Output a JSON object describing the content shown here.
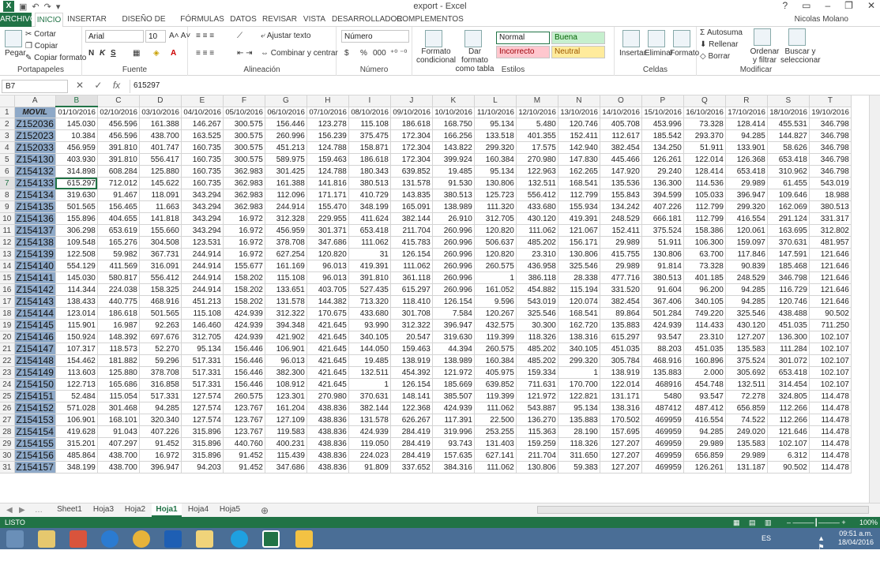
{
  "window": {
    "title": "export - Excel",
    "user": "Nicolas Molano"
  },
  "tabs": [
    "ARCHIVO",
    "INICIO",
    "INSERTAR",
    "DISEÑO DE PÁGINA",
    "FÓRMULAS",
    "DATOS",
    "REVISAR",
    "VISTA",
    "DESARROLLADOR",
    "COMPLEMENTOS"
  ],
  "ribbon": {
    "clipboard": {
      "label": "Portapapeles",
      "paste": "Pegar",
      "cut": "Cortar",
      "copy": "Copiar",
      "format_painter": "Copiar formato"
    },
    "font": {
      "label": "Fuente",
      "family": "Arial",
      "size": "10",
      "bold": "N",
      "italic": "K",
      "underline": "S"
    },
    "alignment": {
      "label": "Alineación",
      "wrap": "Ajustar texto",
      "merge": "Combinar y centrar"
    },
    "number": {
      "label": "Número",
      "format": "Número",
      "currency": "$",
      "percent": "%",
      "thousands": "000"
    },
    "styles": {
      "label": "Estilos",
      "conditional": "Formato condicional",
      "as_table": "Dar formato como tabla",
      "normal": "Normal",
      "good": "Buena",
      "bad": "Incorrecto",
      "neutral": "Neutral"
    },
    "cells": {
      "label": "Celdas",
      "insert": "Insertar",
      "delete": "Eliminar",
      "format": "Formato"
    },
    "editing": {
      "label": "Modificar",
      "autosum": "Autosuma",
      "fill": "Rellenar",
      "clear": "Borrar",
      "sort": "Ordenar y filtrar",
      "find": "Buscar y seleccionar"
    }
  },
  "formula_bar": {
    "name_box": "B7",
    "fx": "fx",
    "content": "615297"
  },
  "columns": [
    "A",
    "B",
    "C",
    "D",
    "E",
    "F",
    "G",
    "H",
    "I",
    "J",
    "K",
    "L",
    "M",
    "N",
    "O",
    "P",
    "Q",
    "R",
    "S",
    "T"
  ],
  "header_row": [
    "MOVIL",
    "01/10/2016",
    "02/10/2016",
    "03/10/2016",
    "04/10/2016",
    "05/10/2016",
    "06/10/2016",
    "07/10/2016",
    "08/10/2016",
    "09/10/2016",
    "10/10/2016",
    "11/10/2016",
    "12/10/2016",
    "13/10/2016",
    "14/10/2016",
    "15/10/2016",
    "16/10/2016",
    "17/10/2016",
    "18/10/2016",
    "19/10/2016"
  ],
  "rows": [
    [
      "Z152036",
      "145.030",
      "456.596",
      "161.388",
      "146.267",
      "300.575",
      "156.446",
      "123.278",
      "115.108",
      "186.618",
      "168.750",
      "95.134",
      "5.480",
      "120.746",
      "405.708",
      "453.996",
      "73.328",
      "128.414",
      "455.531",
      "346.798"
    ],
    [
      "Z152023",
      "10.384",
      "456.596",
      "438.700",
      "163.525",
      "300.575",
      "260.996",
      "156.239",
      "375.475",
      "172.304",
      "166.256",
      "133.518",
      "401.355",
      "152.411",
      "112.617",
      "185.542",
      "293.370",
      "94.285",
      "144.827",
      "346.798"
    ],
    [
      "Z152033",
      "456.959",
      "391.810",
      "401.747",
      "160.735",
      "300.575",
      "451.213",
      "124.788",
      "158.871",
      "172.304",
      "143.822",
      "299.320",
      "17.575",
      "142.940",
      "382.454",
      "134.250",
      "51.911",
      "133.901",
      "58.626",
      "346.798"
    ],
    [
      "Z154130",
      "403.930",
      "391.810",
      "556.417",
      "160.735",
      "300.575",
      "589.975",
      "159.463",
      "186.618",
      "172.304",
      "399.924",
      "160.384",
      "270.980",
      "147.830",
      "445.466",
      "126.261",
      "122.014",
      "126.368",
      "653.418",
      "346.798"
    ],
    [
      "Z154132",
      "314.898",
      "608.284",
      "125.880",
      "160.735",
      "362.983",
      "301.425",
      "124.788",
      "180.343",
      "639.852",
      "19.485",
      "95.134",
      "122.963",
      "162.265",
      "147.920",
      "29.240",
      "128.414",
      "653.418",
      "310.962",
      "346.798"
    ],
    [
      "Z154133",
      "615.297",
      "712.012",
      "145.622",
      "160.735",
      "362.983",
      "161.388",
      "141.816",
      "380.513",
      "131.578",
      "91.530",
      "130.806",
      "132.511",
      "168.541",
      "135.536",
      "136.300",
      "114.536",
      "29.989",
      "61.455",
      "543.019"
    ],
    [
      "Z154134",
      "319.630",
      "91.467",
      "118.091",
      "343.294",
      "362.983",
      "112.096",
      "171.171",
      "410.729",
      "143.835",
      "380.513",
      "125.723",
      "556.412",
      "112.799",
      "155.843",
      "394.599",
      "105.033",
      "396.947",
      "109.646",
      "18.988"
    ],
    [
      "Z154135",
      "501.565",
      "156.465",
      "11.663",
      "343.294",
      "362.983",
      "244.914",
      "155.470",
      "348.199",
      "165.091",
      "138.989",
      "111.320",
      "433.680",
      "155.934",
      "134.242",
      "407.226",
      "112.799",
      "299.320",
      "162.069",
      "380.513"
    ],
    [
      "Z154136",
      "155.896",
      "404.655",
      "141.818",
      "343.294",
      "16.972",
      "312.328",
      "229.955",
      "411.624",
      "382.144",
      "26.910",
      "312.705",
      "430.120",
      "419.391",
      "248.529",
      "666.181",
      "112.799",
      "416.554",
      "291.124",
      "331.317"
    ],
    [
      "Z154137",
      "306.298",
      "653.619",
      "155.660",
      "343.294",
      "16.972",
      "456.959",
      "301.371",
      "653.418",
      "211.704",
      "260.996",
      "120.820",
      "111.062",
      "121.067",
      "152.411",
      "375.524",
      "158.386",
      "120.061",
      "163.695",
      "312.802"
    ],
    [
      "Z154138",
      "109.548",
      "165.276",
      "304.508",
      "123.531",
      "16.972",
      "378.708",
      "347.686",
      "111.062",
      "415.783",
      "260.996",
      "506.637",
      "485.202",
      "156.171",
      "29.989",
      "51.911",
      "106.300",
      "159.097",
      "370.631",
      "481.957"
    ],
    [
      "Z154139",
      "122.508",
      "59.982",
      "367.731",
      "244.914",
      "16.972",
      "627.254",
      "120.820",
      "31",
      "126.154",
      "260.996",
      "120.820",
      "23.310",
      "130.806",
      "415.755",
      "130.806",
      "63.700",
      "117.846",
      "147.591",
      "121.646"
    ],
    [
      "Z154140",
      "554.129",
      "411.569",
      "316.091",
      "244.914",
      "155.677",
      "161.169",
      "96.013",
      "419.391",
      "111.062",
      "260.996",
      "260.575",
      "436.958",
      "325.546",
      "29.989",
      "91.814",
      "73.328",
      "90.839",
      "185.468",
      "121.646"
    ],
    [
      "Z154141",
      "145.030",
      "580.817",
      "556.412",
      "244.914",
      "158.202",
      "115.108",
      "96.013",
      "391.810",
      "361.118",
      "260.996",
      "1",
      "386.118",
      "28.338",
      "477.716",
      "380.513",
      "401.185",
      "248.529",
      "346.798",
      "121.646"
    ],
    [
      "Z154142",
      "114.344",
      "224.038",
      "158.325",
      "244.914",
      "158.202",
      "133.651",
      "403.705",
      "527.435",
      "615.297",
      "260.996",
      "161.052",
      "454.882",
      "115.194",
      "331.520",
      "91.604",
      "96.200",
      "94.285",
      "116.729",
      "121.646"
    ],
    [
      "Z154143",
      "138.433",
      "440.775",
      "468.916",
      "451.213",
      "158.202",
      "131.578",
      "144.382",
      "713.320",
      "118.410",
      "126.154",
      "9.596",
      "543.019",
      "120.074",
      "382.454",
      "367.406",
      "340.105",
      "94.285",
      "120.746",
      "121.646"
    ],
    [
      "Z154144",
      "123.014",
      "186.618",
      "501.565",
      "115.108",
      "424.939",
      "312.322",
      "170.675",
      "433.680",
      "301.708",
      "7.584",
      "120.267",
      "325.546",
      "168.541",
      "89.864",
      "501.284",
      "749.220",
      "325.546",
      "438.488",
      "90.502"
    ],
    [
      "Z154145",
      "115.901",
      "16.987",
      "92.263",
      "146.460",
      "424.939",
      "394.348",
      "421.645",
      "93.990",
      "312.322",
      "396.947",
      "432.575",
      "30.300",
      "162.720",
      "135.883",
      "424.939",
      "114.433",
      "430.120",
      "451.035",
      "711.250"
    ],
    [
      "Z154146",
      "150.924",
      "148.392",
      "697.676",
      "312.705",
      "424.939",
      "421.902",
      "421.645",
      "340.105",
      "20.547",
      "319.630",
      "119.399",
      "118.326",
      "138.316",
      "615.297",
      "93.547",
      "23.310",
      "127.207",
      "136.300",
      "102.107"
    ],
    [
      "Z154147",
      "107.317",
      "118.573",
      "52.270",
      "95.134",
      "156.446",
      "106.901",
      "421.645",
      "144.050",
      "159.463",
      "44.394",
      "260.575",
      "485.202",
      "340.105",
      "451.035",
      "88.203",
      "451.035",
      "135.583",
      "111.284",
      "102.107"
    ],
    [
      "Z154148",
      "154.462",
      "181.882",
      "59.296",
      "517.331",
      "156.446",
      "96.013",
      "421.645",
      "19.485",
      "138.919",
      "138.989",
      "160.384",
      "485.202",
      "299.320",
      "305.784",
      "468.916",
      "160.896",
      "375.524",
      "301.072",
      "102.107"
    ],
    [
      "Z154149",
      "113.603",
      "125.880",
      "378.708",
      "517.331",
      "156.446",
      "382.300",
      "421.645",
      "132.511",
      "454.392",
      "121.972",
      "405.975",
      "159.334",
      "1",
      "138.919",
      "135.883",
      "2.000",
      "305.692",
      "653.418",
      "102.107"
    ],
    [
      "Z154150",
      "122.713",
      "165.686",
      "316.858",
      "517.331",
      "156.446",
      "108.912",
      "421.645",
      "1",
      "126.154",
      "185.669",
      "639.852",
      "711.631",
      "170.700",
      "122.014",
      "468916",
      "454.748",
      "132.511",
      "314.454",
      "102.107"
    ],
    [
      "Z154151",
      "52.484",
      "115.054",
      "517.331",
      "127.574",
      "260.575",
      "123.301",
      "270.980",
      "370.631",
      "148.141",
      "385.507",
      "119.399",
      "121.972",
      "122.821",
      "131.171",
      "5480",
      "93.547",
      "72.278",
      "324.805",
      "114.478"
    ],
    [
      "Z154152",
      "571.028",
      "301.468",
      "94.285",
      "127.574",
      "123.767",
      "161.204",
      "438.836",
      "382.144",
      "122.368",
      "424.939",
      "111.062",
      "543.887",
      "95.134",
      "138.316",
      "487412",
      "487.412",
      "656.859",
      "112.266",
      "114.478"
    ],
    [
      "Z154153",
      "106.901",
      "168.101",
      "320.340",
      "127.574",
      "123.767",
      "127.109",
      "438.836",
      "131.578",
      "626.267",
      "117.391",
      "22.500",
      "136.270",
      "135.883",
      "170.502",
      "469959",
      "416.554",
      "74.522",
      "112.266",
      "114.478"
    ],
    [
      "Z154154",
      "419.628",
      "91.043",
      "407.226",
      "315.896",
      "123.767",
      "119.583",
      "438.836",
      "424.939",
      "284.419",
      "319.996",
      "253.255",
      "115.363",
      "28.190",
      "157.695",
      "469959",
      "94.285",
      "249.020",
      "121.646",
      "114.478"
    ],
    [
      "Z154155",
      "315.201",
      "407.297",
      "91.452",
      "315.896",
      "440.760",
      "400.231",
      "438.836",
      "119.050",
      "284.419",
      "93.743",
      "131.403",
      "159.259",
      "118.326",
      "127.207",
      "469959",
      "29.989",
      "135.583",
      "102.107",
      "114.478"
    ],
    [
      "Z154156",
      "485.864",
      "438.700",
      "16.972",
      "315.896",
      "91.452",
      "115.439",
      "438.836",
      "224.023",
      "284.419",
      "157.635",
      "627.141",
      "211.704",
      "311.650",
      "127.207",
      "469959",
      "656.859",
      "29.989",
      "6.312",
      "114.478"
    ],
    [
      "Z154157",
      "348.199",
      "438.700",
      "396.947",
      "94.203",
      "91.452",
      "347.686",
      "438.836",
      "91.809",
      "337.652",
      "384.316",
      "111.062",
      "130.806",
      "59.383",
      "127.207",
      "469959",
      "126.261",
      "131.187",
      "90.502",
      "114.478"
    ]
  ],
  "sheets": [
    "Sheet1",
    "Hoja3",
    "Hoja2",
    "Hoja1",
    "Hoja4",
    "Hoja5"
  ],
  "active_sheet": "Hoja1",
  "status": {
    "mode": "LISTO",
    "zoom": "100%"
  },
  "clock": {
    "lang": "ES",
    "time": "09:51 a.m.",
    "date": "18/04/2016"
  }
}
